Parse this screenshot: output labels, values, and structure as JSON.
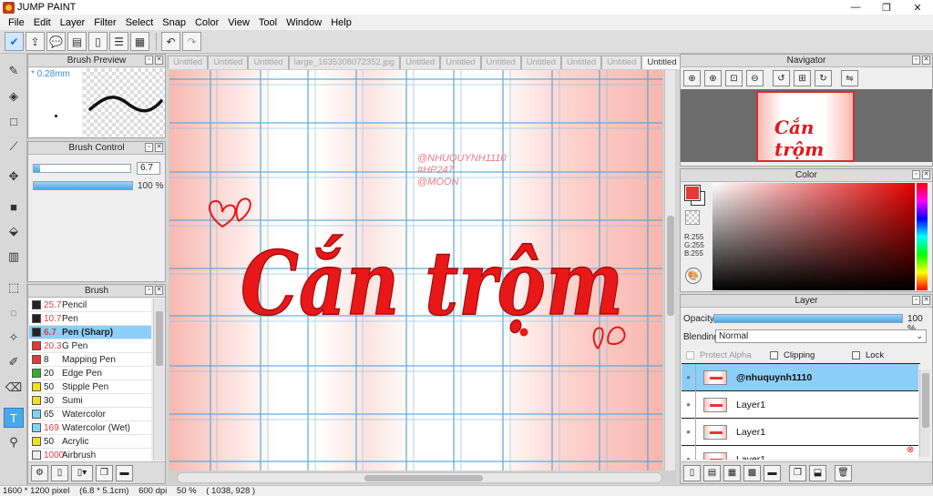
{
  "window": {
    "title": "JUMP PAINT",
    "minimize": "—",
    "maximize": "❐",
    "close": "✕"
  },
  "menu": [
    "File",
    "Edit",
    "Layer",
    "Filter",
    "Select",
    "Snap",
    "Color",
    "View",
    "Tool",
    "Window",
    "Help"
  ],
  "toolbar": {
    "icons": [
      "check-icon",
      "export-icon",
      "speech-bubble-icon",
      "dialog-icon",
      "page-icon",
      "list-icon",
      "edit-list-icon"
    ],
    "undo": "↶",
    "redo": "↷"
  },
  "tools": [
    "pen-icon",
    "eraser-icon",
    "rectangle-icon",
    "line-icon",
    "move-icon",
    "fill-rect-icon",
    "bucket-icon",
    "gradient-icon",
    "select-rect-icon",
    "lasso-icon",
    "magic-wand-icon",
    "select-pen-icon",
    "select-eraser-icon",
    "text-icon",
    "eyedropper-icon"
  ],
  "brush_preview": {
    "title": "Brush Preview",
    "size": "* 0.28mm"
  },
  "brush_control": {
    "title": "Brush Control",
    "size_value": "6.7",
    "size_fraction": 0.07,
    "opacity_value": "100 %",
    "opacity_fraction": 1.0
  },
  "brush": {
    "title": "Brush",
    "items": [
      {
        "size": "25.7",
        "name": "Pencil",
        "color": "#222222",
        "size_red": true,
        "selected": false
      },
      {
        "size": "10.7",
        "name": "Pen",
        "color": "#222222",
        "size_red": true,
        "selected": false
      },
      {
        "size": "6.7",
        "name": "Pen (Sharp)",
        "color": "#222222",
        "size_red": true,
        "selected": true
      },
      {
        "size": "20.3",
        "name": "G Pen",
        "color": "#e53935",
        "size_red": true,
        "selected": false
      },
      {
        "size": "8",
        "name": "Mapping Pen",
        "color": "#e53935",
        "size_red": false,
        "selected": false
      },
      {
        "size": "20",
        "name": "Edge Pen",
        "color": "#2eae36",
        "size_red": false,
        "selected": false
      },
      {
        "size": "50",
        "name": "Stipple Pen",
        "color": "#f0e020",
        "size_red": false,
        "selected": false
      },
      {
        "size": "30",
        "name": "Sumi",
        "color": "#f0e020",
        "size_red": false,
        "selected": false
      },
      {
        "size": "65",
        "name": "Watercolor",
        "color": "#7fd3f5",
        "size_red": false,
        "selected": false
      },
      {
        "size": "169",
        "name": "Watercolor (Wet)",
        "color": "#7fd3f5",
        "size_red": true,
        "selected": false
      },
      {
        "size": "50",
        "name": "Acrylic",
        "color": "#f0e020",
        "size_red": false,
        "selected": false
      },
      {
        "size": "1000",
        "name": "Airbrush",
        "color": "#eeeeee",
        "size_red": true,
        "selected": false
      }
    ]
  },
  "doc_tabs": [
    {
      "label": "Untitled",
      "active": false
    },
    {
      "label": "Untitled",
      "active": false
    },
    {
      "label": "Untitled",
      "active": false
    },
    {
      "label": "large_1635308072352.jpg",
      "active": false
    },
    {
      "label": "Untitled",
      "active": false
    },
    {
      "label": "Untitled",
      "active": false
    },
    {
      "label": "Untitled",
      "active": false
    },
    {
      "label": "Untitled",
      "active": false
    },
    {
      "label": "Untitled",
      "active": false
    },
    {
      "label": "Untitled",
      "active": false
    },
    {
      "label": "Untitled",
      "active": true
    }
  ],
  "canvas": {
    "watermark": [
      "@NHUQUYNH1110",
      "#HP247",
      "@MOON"
    ],
    "main_text": "Cắn trộm",
    "text_color": "#e81818"
  },
  "navigator": {
    "title": "Navigator",
    "thumb_text": "Cắn trộm"
  },
  "color": {
    "title": "Color",
    "rgb": [
      "R:255",
      "G:255",
      "B:255"
    ],
    "fg": "#e53935",
    "bg": "#ffffff"
  },
  "layer": {
    "title": "Layer",
    "opacity_label": "Opacity",
    "opacity_value": "100 %",
    "opacity_fraction": 1.0,
    "blending_label": "Blending",
    "blending_value": "Normal",
    "protect_alpha": "Protect Alpha",
    "clipping": "Clipping",
    "lock": "Lock",
    "layers": [
      {
        "name": "@nhuquynh1110",
        "selected": true
      },
      {
        "name": "Layer1",
        "selected": false
      },
      {
        "name": "Layer1",
        "selected": false
      },
      {
        "name": "Layer1",
        "selected": false
      }
    ]
  },
  "status": {
    "size": "1600 * 1200 pixel",
    "physical": "(6.8 * 5.1cm)",
    "dpi": "600 dpi",
    "zoom": "50 %",
    "coords": "( 1038, 928 )"
  }
}
